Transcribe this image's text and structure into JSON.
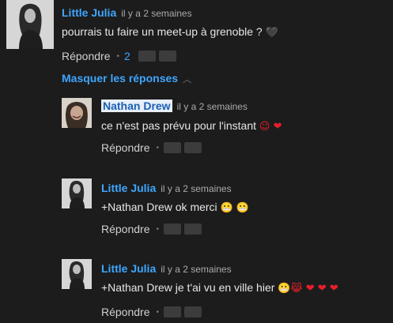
{
  "top_comment": {
    "author": "Little Julia",
    "time": "il y a 2 semaines",
    "text": "pourrais tu faire un meet-up à grenoble ?",
    "text_emoji": "🖤",
    "reply_label": "Répondre",
    "reply_count": "2"
  },
  "toggle_replies": {
    "label": "Masquer les réponses"
  },
  "replies": [
    {
      "author": "Nathan Drew",
      "time": "il y a 2 semaines",
      "text": "ce n'est pas prévu pour l'instant",
      "emoji": "☺ ❤",
      "reply_label": "Répondre"
    },
    {
      "author": "Little Julia",
      "time": "il y a 2 semaines",
      "text": "+Nathan Drew ok merci",
      "emoji": "😬 😬",
      "reply_label": "Répondre"
    },
    {
      "author": "Little Julia",
      "time": "il y a 2 semaines",
      "text": "+Nathan Drew je t'ai vu en ville hier",
      "emoji": "😬😹 ❤ ❤ ❤",
      "reply_label": "Répondre"
    }
  ]
}
